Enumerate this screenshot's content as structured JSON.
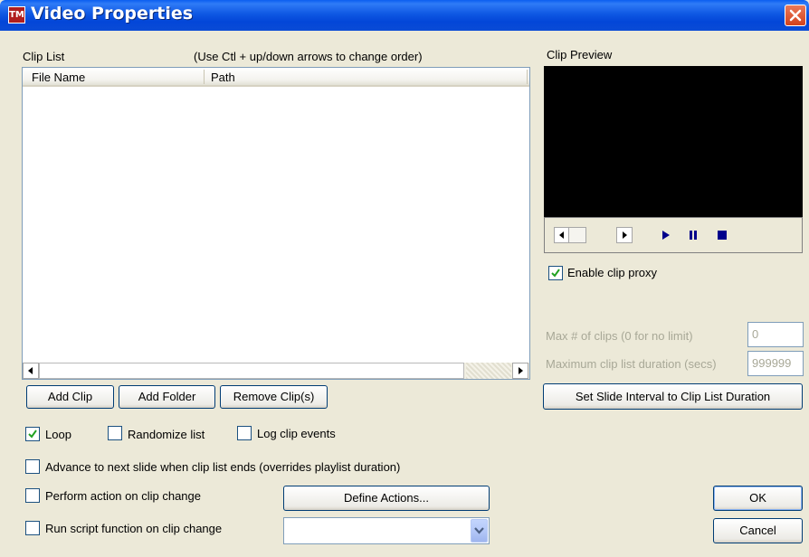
{
  "window": {
    "title": "Video Properties",
    "icon_text": "TM"
  },
  "clip_list": {
    "label": "Clip List",
    "hint": "(Use Ctl + up/down arrows to change order)",
    "columns": [
      "File Name",
      "Path"
    ],
    "rows": []
  },
  "buttons": {
    "add_clip": "Add Clip",
    "add_folder": "Add Folder",
    "remove_clips": "Remove Clip(s)",
    "set_slide_interval": "Set Slide Interval to Clip List Duration",
    "define_actions": "Define Actions...",
    "ok": "OK",
    "cancel": "Cancel"
  },
  "options": {
    "loop": {
      "label": "Loop",
      "checked": true
    },
    "randomize": {
      "label": "Randomize list",
      "checked": false
    },
    "log_events": {
      "label": "Log clip events",
      "checked": false
    },
    "advance": {
      "label": "Advance to next slide when clip list ends (overrides playlist duration)",
      "checked": false
    },
    "perform_action": {
      "label": "Perform action on clip change",
      "checked": false
    },
    "run_script": {
      "label": "Run script function on clip change",
      "checked": false
    }
  },
  "preview": {
    "label": "Clip Preview",
    "enable_proxy": {
      "label": "Enable clip proxy",
      "checked": true
    },
    "max_clips_label": "Max # of clips (0 for no limit)",
    "max_clips_value": "0",
    "max_duration_label": "Maximum clip list duration (secs)",
    "max_duration_value": "999999"
  },
  "script_function": {
    "selected": ""
  },
  "colors": {
    "titlebar": "#0a4bd6",
    "accent_play": "#00008b",
    "checkmark": "#21a121"
  }
}
